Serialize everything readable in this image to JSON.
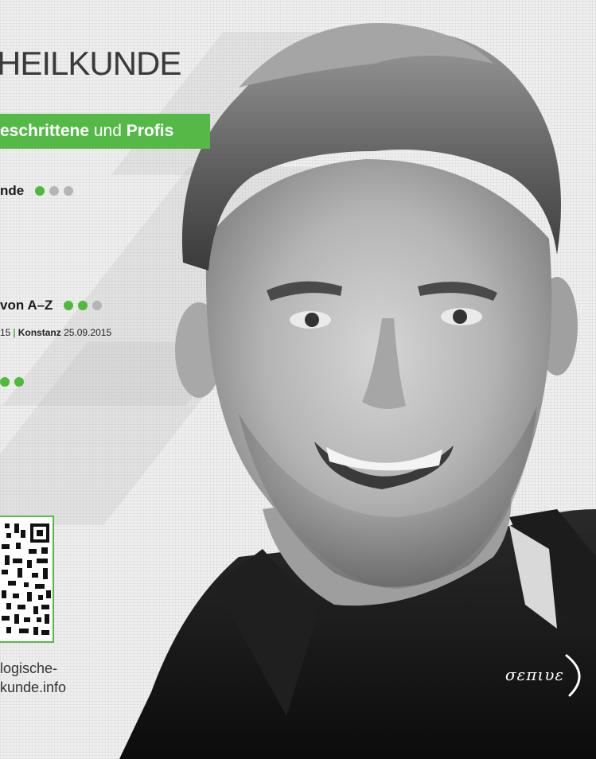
{
  "header": {
    "title": "HEILKUNDE"
  },
  "banner": {
    "part1": "eschrittene",
    "part2": " und ",
    "part3": "Profis"
  },
  "courses": [
    {
      "label": "nde",
      "level": 1,
      "max": 3
    },
    {
      "label": "von A–Z",
      "level": 2,
      "max": 3
    },
    {
      "label": "",
      "level": 2,
      "max": 2
    }
  ],
  "meta": {
    "date1": "15",
    "city": "Konstanz",
    "date2": "25.09.2015"
  },
  "footer": {
    "url_line1": "logische-",
    "url_line2": "kunde.info",
    "logo_text": "σεπιυε"
  },
  "colors": {
    "accent": "#55b947",
    "dot_on": "#4fba3a",
    "dot_off": "#b5b5b5"
  }
}
